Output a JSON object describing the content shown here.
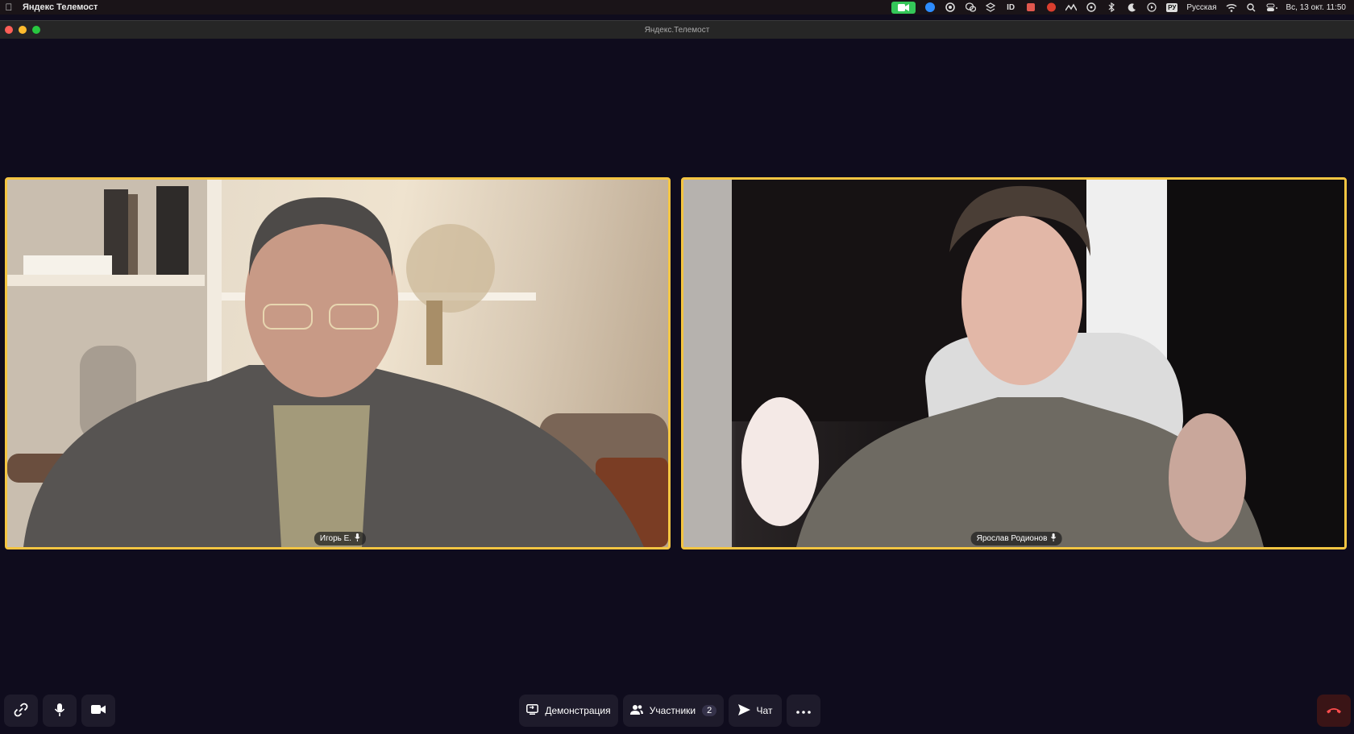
{
  "menubar": {
    "app_name": "Яндекс Телемост",
    "keyboard_badge": "РУ",
    "keyboard_name": "Русская",
    "datetime": "Вс, 13 окт.  11:50",
    "icons": [
      "camera-in-use-icon",
      "zoom-icon",
      "chrome-icon",
      "wechat-icon",
      "dropbox-icon",
      "id-icon",
      "app-icon",
      "creative-cloud-icon",
      "app-mountain-icon",
      "vpn-icon",
      "bluetooth-icon",
      "moon-icon",
      "play-icon",
      "wifi-icon",
      "spotlight-icon",
      "control-center-icon"
    ]
  },
  "window": {
    "title": "Яндекс.Телемост"
  },
  "participants": [
    {
      "name": "Игорь Е.",
      "mic": "mic-icon"
    },
    {
      "name": "Ярослав Родионов",
      "mic": "mic-icon"
    }
  ],
  "toolbar": {
    "demo_label": "Демонстрация",
    "participants_label": "Участники",
    "participants_count": "2",
    "chat_label": "Чат"
  },
  "colors": {
    "background": "#0f0c1d",
    "active_speaker_border": "#f4c542",
    "button_bg": "#1e1b2b",
    "hangup_bg": "#3a1416",
    "hangup_icon": "#ff4d4d"
  }
}
